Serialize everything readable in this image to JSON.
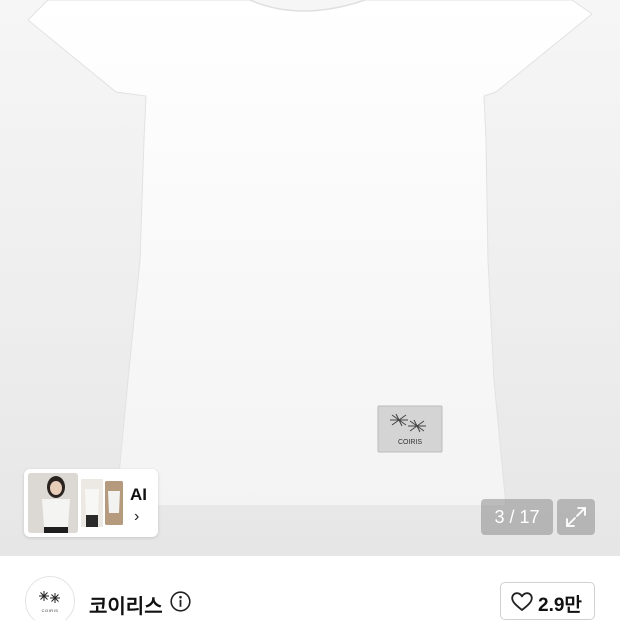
{
  "gallery": {
    "page_counter": "3 / 17",
    "patch_label_text": "COIRIS"
  },
  "ai_card": {
    "label": "AI",
    "chevron": "›"
  },
  "brand": {
    "name": "코이리스",
    "logo_text": "COIRIS"
  },
  "like": {
    "count": "2.9만"
  },
  "icons": {
    "expand": "expand-icon",
    "info": "info-icon",
    "heart": "heart-icon",
    "chevron": "chevron-right-icon"
  }
}
